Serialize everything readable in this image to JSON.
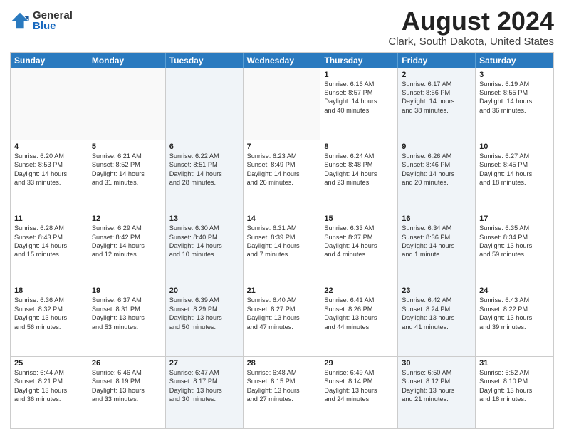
{
  "logo": {
    "general": "General",
    "blue": "Blue"
  },
  "title": "August 2024",
  "subtitle": "Clark, South Dakota, United States",
  "days_of_week": [
    "Sunday",
    "Monday",
    "Tuesday",
    "Wednesday",
    "Thursday",
    "Friday",
    "Saturday"
  ],
  "weeks": [
    [
      {
        "day": "",
        "info": "",
        "shaded": false
      },
      {
        "day": "",
        "info": "",
        "shaded": false
      },
      {
        "day": "",
        "info": "",
        "shaded": true
      },
      {
        "day": "",
        "info": "",
        "shaded": false
      },
      {
        "day": "1",
        "info": "Sunrise: 6:16 AM\nSunset: 8:57 PM\nDaylight: 14 hours\nand 40 minutes.",
        "shaded": false
      },
      {
        "day": "2",
        "info": "Sunrise: 6:17 AM\nSunset: 8:56 PM\nDaylight: 14 hours\nand 38 minutes.",
        "shaded": true
      },
      {
        "day": "3",
        "info": "Sunrise: 6:19 AM\nSunset: 8:55 PM\nDaylight: 14 hours\nand 36 minutes.",
        "shaded": false
      }
    ],
    [
      {
        "day": "4",
        "info": "Sunrise: 6:20 AM\nSunset: 8:53 PM\nDaylight: 14 hours\nand 33 minutes.",
        "shaded": false
      },
      {
        "day": "5",
        "info": "Sunrise: 6:21 AM\nSunset: 8:52 PM\nDaylight: 14 hours\nand 31 minutes.",
        "shaded": false
      },
      {
        "day": "6",
        "info": "Sunrise: 6:22 AM\nSunset: 8:51 PM\nDaylight: 14 hours\nand 28 minutes.",
        "shaded": true
      },
      {
        "day": "7",
        "info": "Sunrise: 6:23 AM\nSunset: 8:49 PM\nDaylight: 14 hours\nand 26 minutes.",
        "shaded": false
      },
      {
        "day": "8",
        "info": "Sunrise: 6:24 AM\nSunset: 8:48 PM\nDaylight: 14 hours\nand 23 minutes.",
        "shaded": false
      },
      {
        "day": "9",
        "info": "Sunrise: 6:26 AM\nSunset: 8:46 PM\nDaylight: 14 hours\nand 20 minutes.",
        "shaded": true
      },
      {
        "day": "10",
        "info": "Sunrise: 6:27 AM\nSunset: 8:45 PM\nDaylight: 14 hours\nand 18 minutes.",
        "shaded": false
      }
    ],
    [
      {
        "day": "11",
        "info": "Sunrise: 6:28 AM\nSunset: 8:43 PM\nDaylight: 14 hours\nand 15 minutes.",
        "shaded": false
      },
      {
        "day": "12",
        "info": "Sunrise: 6:29 AM\nSunset: 8:42 PM\nDaylight: 14 hours\nand 12 minutes.",
        "shaded": false
      },
      {
        "day": "13",
        "info": "Sunrise: 6:30 AM\nSunset: 8:40 PM\nDaylight: 14 hours\nand 10 minutes.",
        "shaded": true
      },
      {
        "day": "14",
        "info": "Sunrise: 6:31 AM\nSunset: 8:39 PM\nDaylight: 14 hours\nand 7 minutes.",
        "shaded": false
      },
      {
        "day": "15",
        "info": "Sunrise: 6:33 AM\nSunset: 8:37 PM\nDaylight: 14 hours\nand 4 minutes.",
        "shaded": false
      },
      {
        "day": "16",
        "info": "Sunrise: 6:34 AM\nSunset: 8:36 PM\nDaylight: 14 hours\nand 1 minute.",
        "shaded": true
      },
      {
        "day": "17",
        "info": "Sunrise: 6:35 AM\nSunset: 8:34 PM\nDaylight: 13 hours\nand 59 minutes.",
        "shaded": false
      }
    ],
    [
      {
        "day": "18",
        "info": "Sunrise: 6:36 AM\nSunset: 8:32 PM\nDaylight: 13 hours\nand 56 minutes.",
        "shaded": false
      },
      {
        "day": "19",
        "info": "Sunrise: 6:37 AM\nSunset: 8:31 PM\nDaylight: 13 hours\nand 53 minutes.",
        "shaded": false
      },
      {
        "day": "20",
        "info": "Sunrise: 6:39 AM\nSunset: 8:29 PM\nDaylight: 13 hours\nand 50 minutes.",
        "shaded": true
      },
      {
        "day": "21",
        "info": "Sunrise: 6:40 AM\nSunset: 8:27 PM\nDaylight: 13 hours\nand 47 minutes.",
        "shaded": false
      },
      {
        "day": "22",
        "info": "Sunrise: 6:41 AM\nSunset: 8:26 PM\nDaylight: 13 hours\nand 44 minutes.",
        "shaded": false
      },
      {
        "day": "23",
        "info": "Sunrise: 6:42 AM\nSunset: 8:24 PM\nDaylight: 13 hours\nand 41 minutes.",
        "shaded": true
      },
      {
        "day": "24",
        "info": "Sunrise: 6:43 AM\nSunset: 8:22 PM\nDaylight: 13 hours\nand 39 minutes.",
        "shaded": false
      }
    ],
    [
      {
        "day": "25",
        "info": "Sunrise: 6:44 AM\nSunset: 8:21 PM\nDaylight: 13 hours\nand 36 minutes.",
        "shaded": false
      },
      {
        "day": "26",
        "info": "Sunrise: 6:46 AM\nSunset: 8:19 PM\nDaylight: 13 hours\nand 33 minutes.",
        "shaded": false
      },
      {
        "day": "27",
        "info": "Sunrise: 6:47 AM\nSunset: 8:17 PM\nDaylight: 13 hours\nand 30 minutes.",
        "shaded": true
      },
      {
        "day": "28",
        "info": "Sunrise: 6:48 AM\nSunset: 8:15 PM\nDaylight: 13 hours\nand 27 minutes.",
        "shaded": false
      },
      {
        "day": "29",
        "info": "Sunrise: 6:49 AM\nSunset: 8:14 PM\nDaylight: 13 hours\nand 24 minutes.",
        "shaded": false
      },
      {
        "day": "30",
        "info": "Sunrise: 6:50 AM\nSunset: 8:12 PM\nDaylight: 13 hours\nand 21 minutes.",
        "shaded": true
      },
      {
        "day": "31",
        "info": "Sunrise: 6:52 AM\nSunset: 8:10 PM\nDaylight: 13 hours\nand 18 minutes.",
        "shaded": false
      }
    ]
  ]
}
